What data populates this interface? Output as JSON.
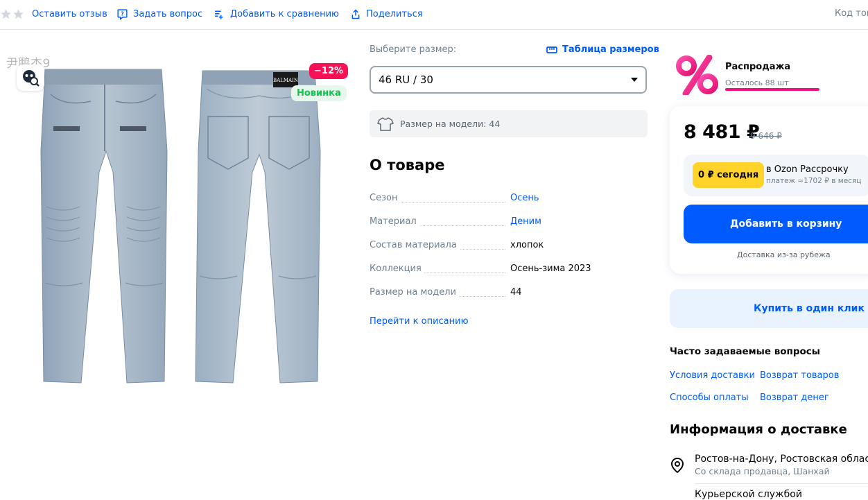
{
  "topbar": {
    "review_label": "Оставить отзыв",
    "question_label": "Задать вопрос",
    "compare_label": "Добавить к сравнению",
    "share_label": "Поделиться",
    "code_label": "Код тов"
  },
  "gallery": {
    "watermark": "尹鹏杰9",
    "discount_badge": "−12%",
    "new_badge": "Новинка",
    "brand_tag": "BALMAIN"
  },
  "size": {
    "label": "Выберите размер:",
    "table_label": "Таблица размеров",
    "selected": "46 RU / 30",
    "model_size": "Размер на модели: 44"
  },
  "about": {
    "title": "О товаре",
    "specs": [
      {
        "key": "Сезон",
        "value": "Осень",
        "link": true
      },
      {
        "key": "Материал",
        "value": "Деним",
        "link": true
      },
      {
        "key": "Состав материала",
        "value": "хлопок",
        "link": false
      },
      {
        "key": "Коллекция",
        "value": "Осень-зима 2023",
        "link": false
      },
      {
        "key": "Размер на модели",
        "value": "44",
        "link": false
      }
    ],
    "goto_desc": "Перейти к описанию"
  },
  "promo": {
    "title": "Распродажа",
    "remaining": "Осталось 88 шт"
  },
  "price": {
    "current": "8 481 ₽",
    "old": "9 646 ₽",
    "installment_pill": "0 ₽ сегодня",
    "installment_text": "в Ozon Рассрочку",
    "installment_sub": "платеж ≈1702 ₽ в месяц",
    "add_to_cart": "Добавить в корзину",
    "delivery_abroad": "Доставка из-за рубежа",
    "one_click": "Купить в один клик"
  },
  "faq": {
    "title": "Часто задаваемые вопросы",
    "links": [
      "Условия доставки",
      "Возврат товаров",
      "Способы оплаты",
      "Возврат денег"
    ]
  },
  "delivery": {
    "title": "Информация о доставке",
    "city": "Ростов-на-Дону, Ростовская област",
    "source": "Со склада продавца, Шанхай",
    "courier": "Курьерской службой"
  },
  "colors": {
    "accent": "#005bff",
    "discount": "#f91155",
    "new": "#10c44c",
    "installment": "#ffd32a",
    "promo": "#f1117e"
  }
}
